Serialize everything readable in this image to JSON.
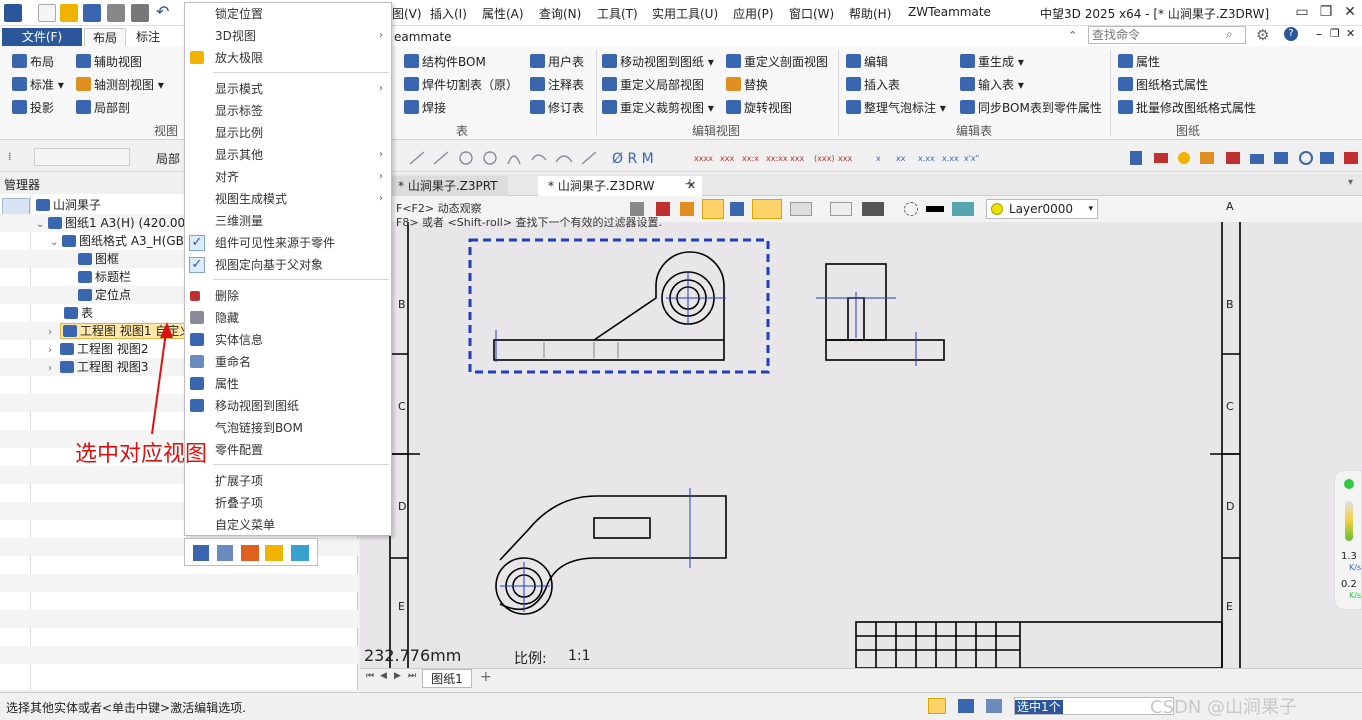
{
  "titlebar": {
    "menus": [
      "图(V)",
      "插入(I)",
      "属性(A)",
      "查询(N)",
      "工具(T)",
      "实用工具(U)",
      "应用(P)",
      "窗口(W)",
      "帮助(H)",
      "ZWTeammate"
    ],
    "window_title": "中望3D 2025 x64 - [* 山涧果子.Z3DRW]"
  },
  "ribbon_tabs": {
    "file": "文件(F)",
    "layout": "布局",
    "annotation": "标注",
    "teammate": "eammate"
  },
  "search": {
    "placeholder": "查找命令"
  },
  "ribbon": {
    "view_group": {
      "items": [
        "布局",
        "标准",
        "投影",
        "辅助视图",
        "轴测剖视图",
        "局部剖"
      ],
      "label": "视图"
    },
    "table_group": {
      "items": [
        "结构件BOM",
        "焊件切割表（原）",
        "焊接",
        "用户表",
        "注释表",
        "修订表"
      ],
      "label": "表"
    },
    "edit_view_group": {
      "items": [
        "移动视图到图纸",
        "重定义局部视图",
        "重定义裁剪视图",
        "重定义剖面视图",
        "替换",
        "旋转视图"
      ],
      "label": "编辑视图"
    },
    "edit_table_group": {
      "items": [
        "编辑",
        "插入表",
        "整理气泡标注",
        "重生成",
        "输入表",
        "同步BOM表到零件属性"
      ],
      "label": "编辑表"
    },
    "sheet_group": {
      "items": [
        "属性",
        "图纸格式属性",
        "批量修改图纸格式属性"
      ],
      "label": "图纸"
    }
  },
  "toolbar2": {
    "partial_label": "局部"
  },
  "manager": {
    "title": "管理器"
  },
  "tree": {
    "items": [
      "山涧果子",
      "图纸1 A3(H) (420.00 x",
      "图纸格式 A3_H(GB)",
      "图框",
      "标题栏",
      "定位点",
      "表",
      "工程图 视图1 自定义",
      "工程图 视图2",
      "工程图 视图3"
    ]
  },
  "doc_tabs": [
    "* 山涧果子.Z3PRT",
    "* 山涧果子.Z3DRW"
  ],
  "hints": {
    "line1": "F<F2> 动态观察",
    "line2": "F8> 或者 <Shift-roll> 查找下一个有效的过滤器设置."
  },
  "layer": {
    "value": "Layer0000"
  },
  "canvas": {
    "distance": "232.776mm",
    "scale_label": "比例:",
    "scale_value": "1:1",
    "row_labels": [
      "A",
      "B",
      "C",
      "D",
      "E"
    ]
  },
  "context_menu": {
    "items": [
      "锁定位置",
      "3D视图",
      "放大极限",
      "显示模式",
      "显示标签",
      "显示比例",
      "显示其他",
      "对齐",
      "视图生成模式",
      "三维测量",
      "组件可见性来源于零件",
      "视图定向基于父对象",
      "删除",
      "隐藏",
      "实体信息",
      "重命名",
      "属性",
      "移动视图到图纸",
      "气泡链接到BOM",
      "零件配置",
      "扩展子项",
      "折叠子项",
      "自定义菜单"
    ],
    "check_mark": "✓"
  },
  "annotation": {
    "text": "选中对应视图"
  },
  "sheet_tab": {
    "label": "图纸1"
  },
  "status": {
    "prompt": "选择其他实体或者<单击中键>激活编辑选项.",
    "selection": "选中1个",
    "watermark": "CSDN @山涧果子"
  },
  "perf": {
    "up": "1.3",
    "up_unit": "K/s",
    "down": "0.2",
    "down_unit": "K/s"
  },
  "colors": {
    "accent": "#2b579a",
    "selection_border": "#1f3fbf",
    "annotation": "#e01010"
  }
}
